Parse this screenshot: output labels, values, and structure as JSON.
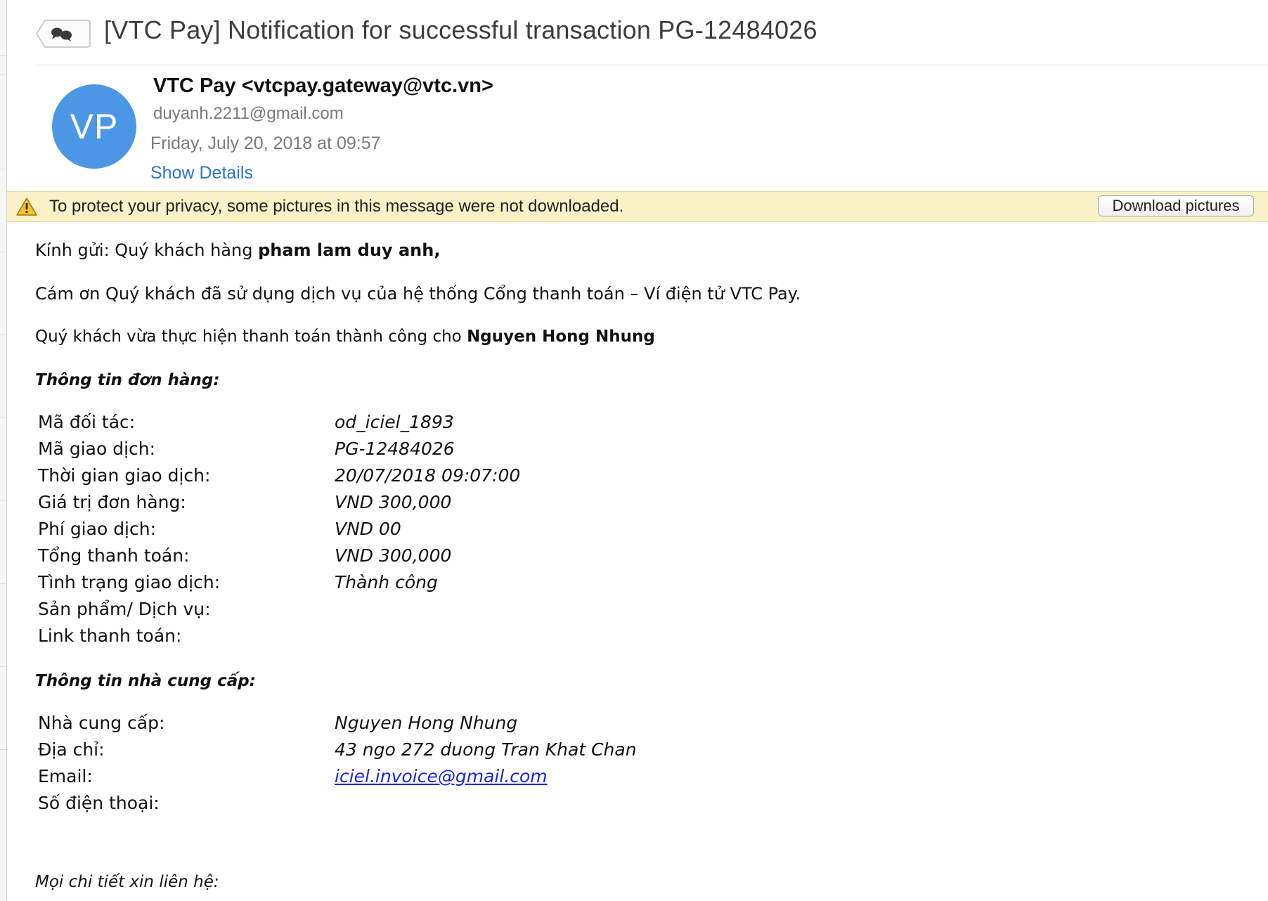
{
  "email": {
    "subject": "[VTC Pay] Notification for successful transaction PG-12484026",
    "avatar_initials": "VP",
    "sender": "VTC Pay <vtcpay.gateway@vtc.vn>",
    "recipient": "duyanh.2211@gmail.com",
    "date": "Friday, July 20, 2018 at 09:57",
    "show_details_label": "Show Details"
  },
  "privacy_banner": {
    "text": "To protect your privacy, some pictures in this message were not downloaded.",
    "button_label": "Download pictures"
  },
  "body": {
    "greeting_prefix": "Kính gửi: Quý khách hàng ",
    "customer_name": "pham lam duy anh",
    "greeting_suffix": ",",
    "thanks": "Cám ơn Quý khách đã sử dụng dịch vụ của hệ thống Cổng thanh toán – Ví điện tử VTC Pay.",
    "payment_prefix": "Quý khách vừa thực hiện thanh toán thành công cho ",
    "payee": "Nguyen Hong Nhung",
    "order_section_title": "Thông tin đơn hàng:",
    "order_rows": [
      {
        "label": "Mã đối tác:",
        "value": "od_iciel_1893"
      },
      {
        "label": "Mã giao dịch:",
        "value": "PG-12484026"
      },
      {
        "label": "Thời gian giao dịch:",
        "value": "20/07/2018 09:07:00"
      },
      {
        "label": "Giá trị đơn hàng:",
        "value": "VND 300,000"
      },
      {
        "label": "Phí giao dịch:",
        "value": "VND 00"
      },
      {
        "label": "Tổng thanh toán:",
        "value": "VND 300,000"
      },
      {
        "label": "Tình trạng giao dịch:",
        "value": "Thành công"
      },
      {
        "label": "Sản phẩm/ Dịch vụ:",
        "value": ""
      },
      {
        "label": "Link thanh toán:",
        "value": ""
      }
    ],
    "provider_section_title": "Thông tin nhà cung cấp:",
    "provider_rows": [
      {
        "label": "Nhà cung cấp:",
        "value": "Nguyen Hong Nhung"
      },
      {
        "label": "Địa chỉ:",
        "value": "43 ngo 272 duong Tran Khat Chan"
      },
      {
        "label": "Email:",
        "value": "iciel.invoice@gmail.com"
      },
      {
        "label": "Số điện thoại:",
        "value": ""
      }
    ],
    "contact_note": "Mọi chi tiết xin liên hệ:"
  },
  "colors": {
    "avatar": "#4b97e6",
    "link": "#2b74d8",
    "email_link": "#1a26d8",
    "banner": "#fbf1c8"
  },
  "icons": [
    "conversation-icon",
    "warning-icon"
  ]
}
